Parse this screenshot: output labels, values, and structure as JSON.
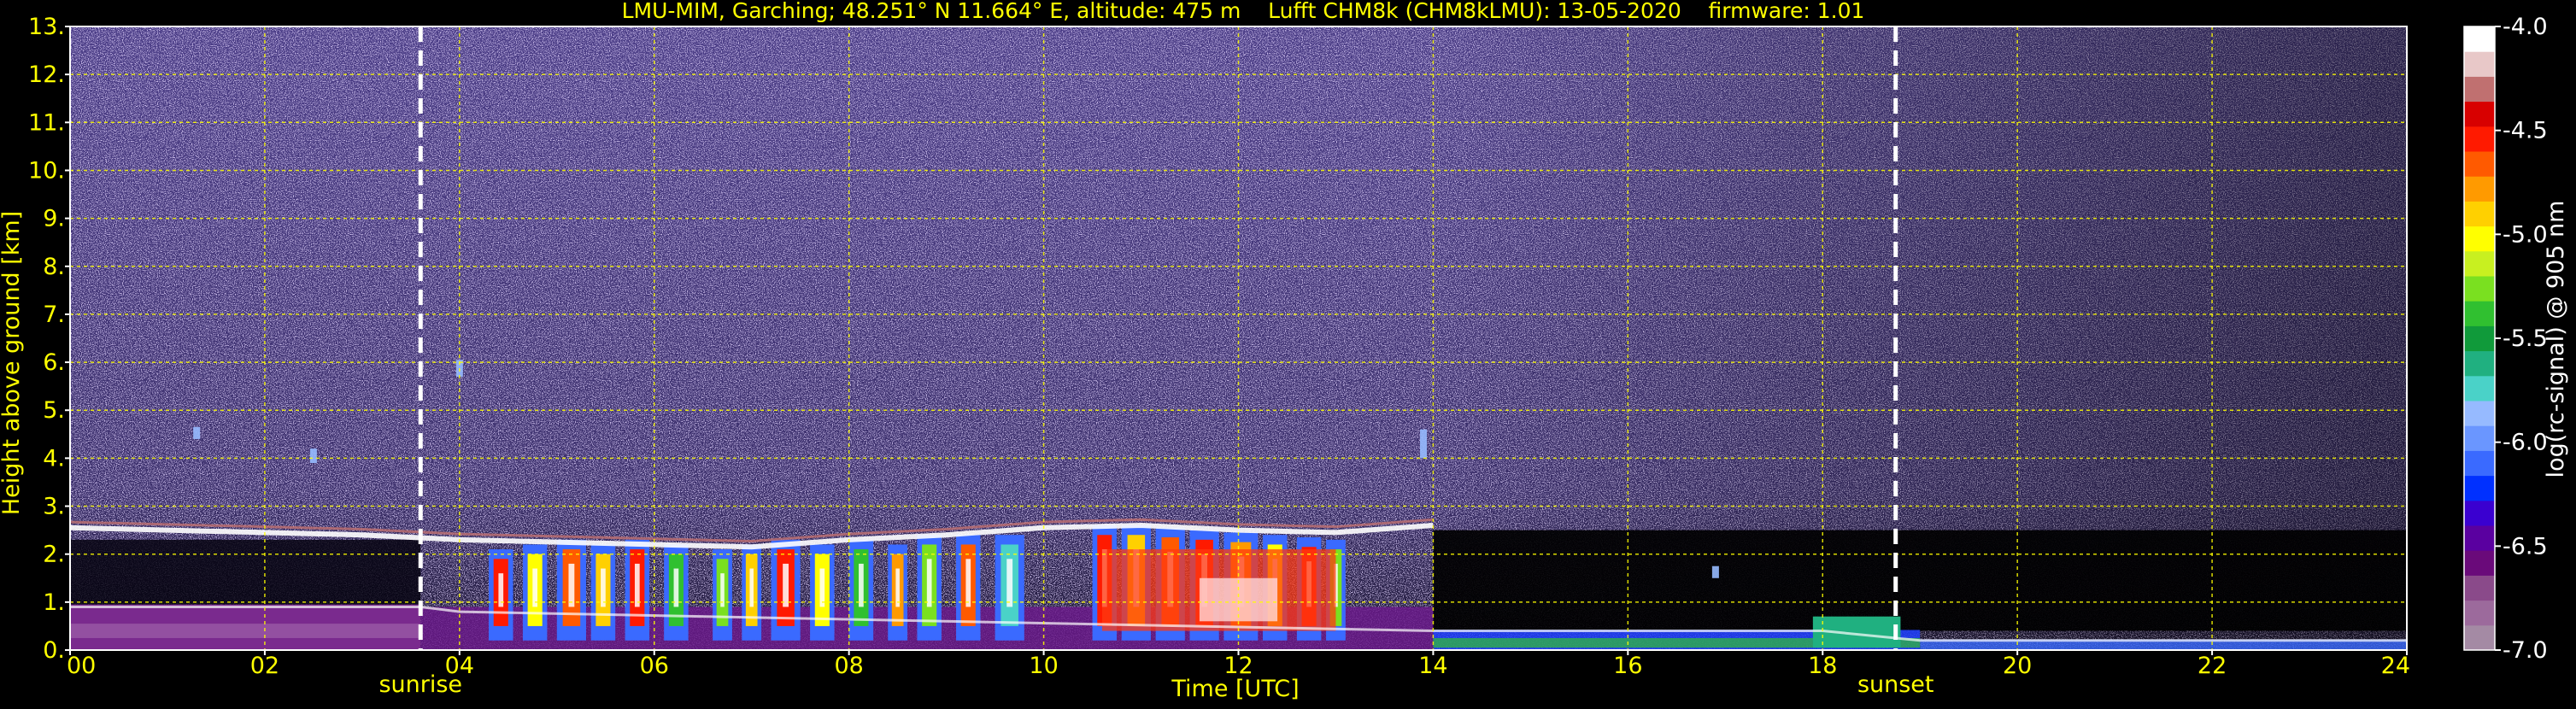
{
  "chart_data": {
    "type": "heatmap",
    "title": "LMU-MIM, Garching; 48.251° N 11.664° E, altitude: 475 m    Lufft CHM8k (CHM8kLMU): 13-05-2020    firmware: 1.01",
    "xlabel": "Time [UTC]",
    "ylabel": "Height above ground [km]",
    "xlim": [
      0,
      24
    ],
    "ylim": [
      0,
      13
    ],
    "x_ticks": [
      {
        "value": 0,
        "label": "00"
      },
      {
        "value": 2,
        "label": "02"
      },
      {
        "value": 4,
        "label": "04"
      },
      {
        "value": 6,
        "label": "06"
      },
      {
        "value": 8,
        "label": "08"
      },
      {
        "value": 10,
        "label": "10"
      },
      {
        "value": 12,
        "label": "12"
      },
      {
        "value": 14,
        "label": "14"
      },
      {
        "value": 16,
        "label": "16"
      },
      {
        "value": 18,
        "label": "18"
      },
      {
        "value": 20,
        "label": "20"
      },
      {
        "value": 22,
        "label": "22"
      },
      {
        "value": 24,
        "label": "24"
      }
    ],
    "y_ticks": [
      {
        "value": 0,
        "label": "0."
      },
      {
        "value": 1,
        "label": "1."
      },
      {
        "value": 2,
        "label": "2."
      },
      {
        "value": 3,
        "label": "3."
      },
      {
        "value": 4,
        "label": "4."
      },
      {
        "value": 5,
        "label": "5."
      },
      {
        "value": 6,
        "label": "6."
      },
      {
        "value": 7,
        "label": "7."
      },
      {
        "value": 8,
        "label": "8."
      },
      {
        "value": 9,
        "label": "9."
      },
      {
        "value": 10,
        "label": "10."
      },
      {
        "value": 11,
        "label": "11."
      },
      {
        "value": 12,
        "label": "12."
      },
      {
        "value": 13,
        "label": "13."
      }
    ],
    "grid": true,
    "markers": [
      {
        "label": "sunrise",
        "time": 3.6
      },
      {
        "label": "sunset",
        "time": 18.75
      }
    ],
    "colorbar": {
      "label": "log(rc-signal) @ 905 nm",
      "range": [
        -7.0,
        -4.0
      ],
      "ticks": [
        {
          "value": -4.0,
          "label": "-4.0"
        },
        {
          "value": -4.5,
          "label": "-4.5"
        },
        {
          "value": -5.0,
          "label": "-5.0"
        },
        {
          "value": -5.5,
          "label": "-5.5"
        },
        {
          "value": -6.0,
          "label": "-6.0"
        },
        {
          "value": -6.5,
          "label": "-6.5"
        },
        {
          "value": -7.0,
          "label": "-7.0"
        }
      ],
      "colors": [
        "#a48aa4",
        "#9c6a9c",
        "#8a4a8a",
        "#6a0a7a",
        "#5a00a0",
        "#3a00d0",
        "#0030ff",
        "#3a6aff",
        "#6a96ff",
        "#96baff",
        "#4ad2c8",
        "#20b080",
        "#109a3a",
        "#30c030",
        "#7ae020",
        "#c8f020",
        "#ffff00",
        "#ffd000",
        "#ff9a00",
        "#ff5a00",
        "#ff1a00",
        "#d80000",
        "#c07070",
        "#e8c8c8",
        "#ffffff"
      ]
    },
    "layers": [
      {
        "name": "boundary-layer-top",
        "points": [
          [
            0,
            2.55
          ],
          [
            1,
            2.5
          ],
          [
            2,
            2.45
          ],
          [
            3,
            2.4
          ],
          [
            4,
            2.3
          ],
          [
            5,
            2.25
          ],
          [
            6,
            2.2
          ],
          [
            7,
            2.15
          ],
          [
            8,
            2.3
          ],
          [
            9,
            2.4
          ],
          [
            10,
            2.55
          ],
          [
            11,
            2.6
          ],
          [
            12,
            2.5
          ],
          [
            13,
            2.45
          ],
          [
            14,
            2.6
          ]
        ]
      },
      {
        "name": "residual-layer-bottom",
        "points": [
          [
            0,
            0.9
          ],
          [
            3.6,
            0.9
          ],
          [
            4,
            0.8
          ],
          [
            14,
            0.4
          ],
          [
            18,
            0.4
          ],
          [
            19,
            0.2
          ],
          [
            24,
            0.2
          ]
        ]
      }
    ]
  },
  "colors": {
    "axis": "#ffffff",
    "text": "#ffff00",
    "grid": "#ffff00",
    "background": "#000000"
  }
}
